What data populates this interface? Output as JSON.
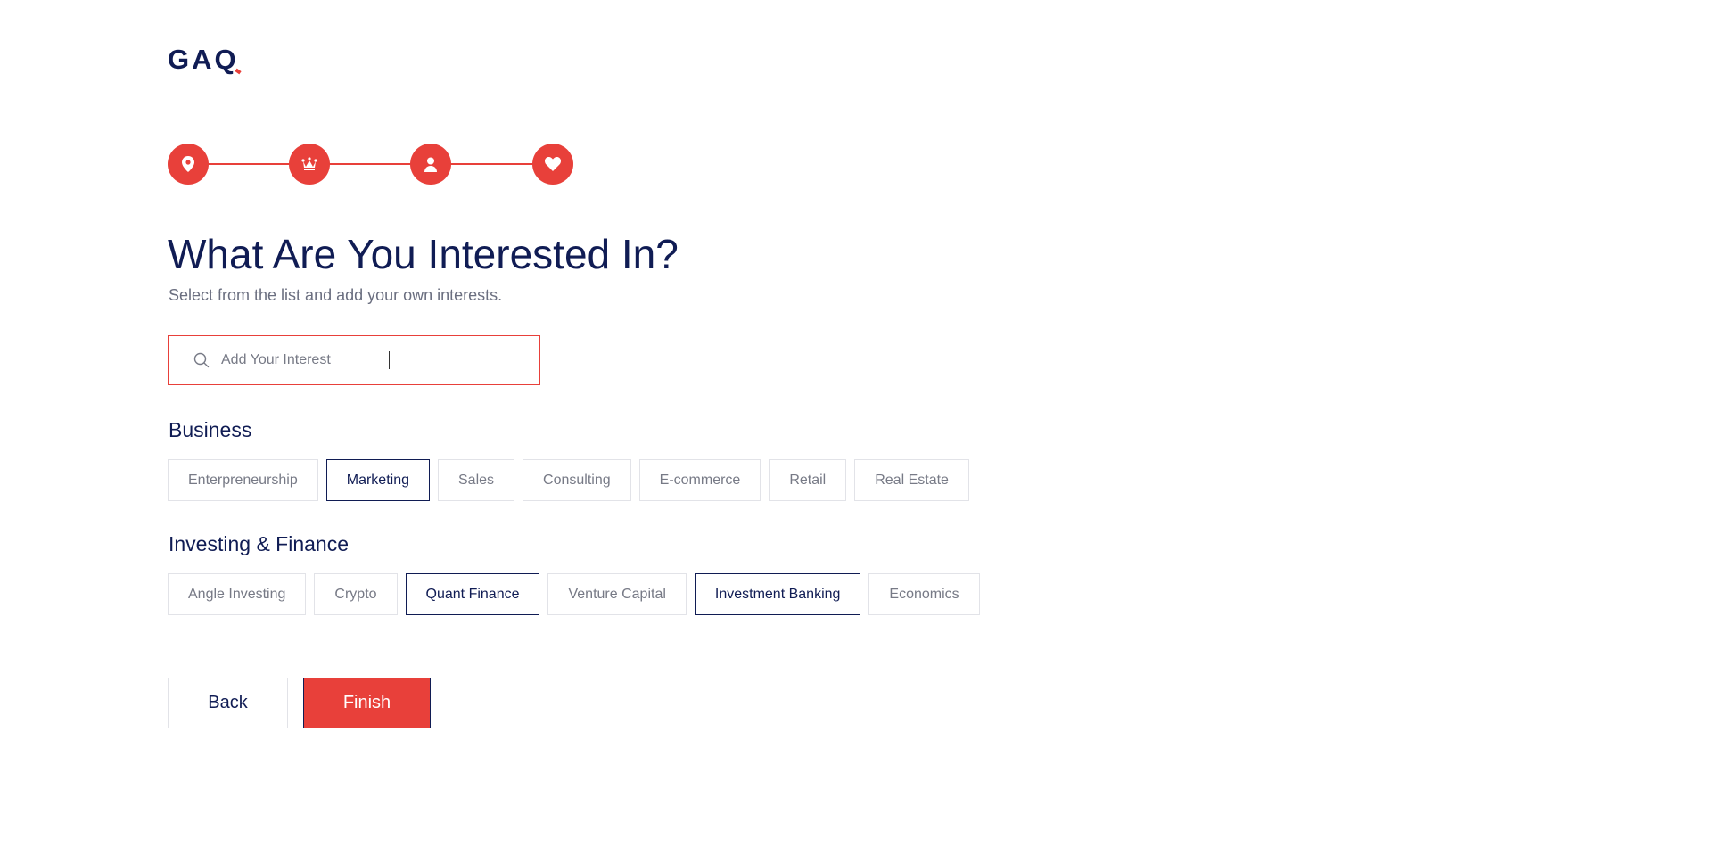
{
  "logo": {
    "text": "GAQ"
  },
  "stepper": {
    "steps": [
      {
        "icon": "location-pin-icon",
        "state": "complete"
      },
      {
        "icon": "crown-icon",
        "state": "complete"
      },
      {
        "icon": "user-icon",
        "state": "complete"
      },
      {
        "icon": "heart-icon",
        "state": "active"
      }
    ],
    "color": "#e8403a"
  },
  "header": {
    "title": "What Are You Interested In?",
    "subtitle": "Select from the list and add your own interests."
  },
  "search": {
    "placeholder": "Add Your Interest",
    "value": "",
    "icon": "search-icon"
  },
  "sections": [
    {
      "title": "Business",
      "chips": [
        {
          "label": "Enterpreneurship",
          "selected": false
        },
        {
          "label": "Marketing",
          "selected": true
        },
        {
          "label": "Sales",
          "selected": false
        },
        {
          "label": "Consulting",
          "selected": false
        },
        {
          "label": "E-commerce",
          "selected": false
        },
        {
          "label": "Retail",
          "selected": false
        },
        {
          "label": "Real Estate",
          "selected": false
        }
      ]
    },
    {
      "title": "Investing & Finance",
      "chips": [
        {
          "label": "Angle Investing",
          "selected": false
        },
        {
          "label": "Crypto",
          "selected": false
        },
        {
          "label": "Quant Finance",
          "selected": true
        },
        {
          "label": "Venture Capital",
          "selected": false
        },
        {
          "label": "Investment Banking",
          "selected": true
        },
        {
          "label": "Economics",
          "selected": false
        }
      ]
    }
  ],
  "actions": {
    "back_label": "Back",
    "finish_label": "Finish"
  },
  "colors": {
    "brand_navy": "#101c54",
    "accent_red": "#e8403a",
    "muted_text": "#777a86",
    "chip_border": "#e2e3e8"
  }
}
